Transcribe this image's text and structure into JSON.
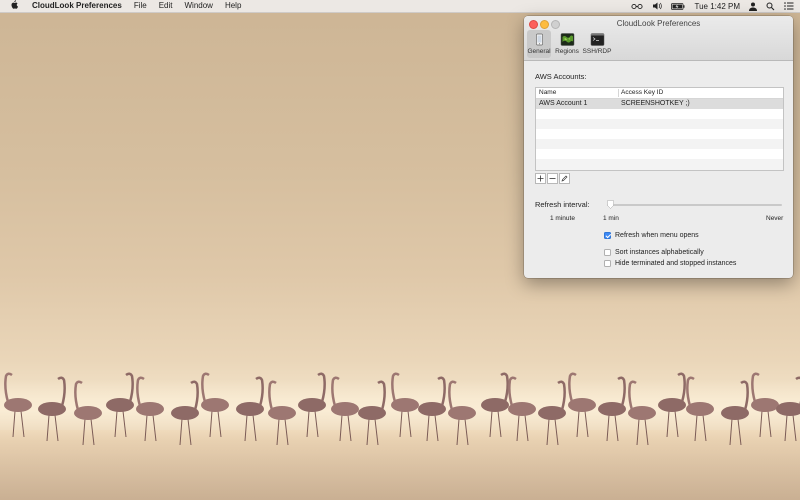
{
  "menubar": {
    "app_name": "CloudLook Preferences",
    "menus": [
      "File",
      "Edit",
      "Window",
      "Help"
    ],
    "clock": "Tue 1:42 PM",
    "status_icons": [
      "cloudlook-glasses-icon",
      "volume-icon",
      "battery-icon",
      "user-icon",
      "spotlight-search-icon",
      "notification-list-icon"
    ]
  },
  "window": {
    "title": "CloudLook Preferences",
    "toolbar": [
      {
        "label": "General",
        "icon": "general-phone-icon",
        "selected": true
      },
      {
        "label": "Regions",
        "icon": "regions-map-icon",
        "selected": false
      },
      {
        "label": "SSH/RDP",
        "icon": "terminal-icon",
        "selected": false
      }
    ],
    "aws_accounts_label": "AWS Accounts:",
    "table": {
      "columns": [
        "Name",
        "Access Key ID"
      ],
      "rows": [
        {
          "name": "AWS Account 1",
          "key": "SCREENSHOTKEY ;)",
          "selected": true
        }
      ]
    },
    "table_buttons": [
      "add-icon",
      "remove-icon",
      "edit-pencil-icon"
    ],
    "refresh": {
      "label": "Refresh interval:",
      "tick_labels": [
        "1 minute",
        "1 min",
        "Never"
      ],
      "slider_value": "1 min"
    },
    "options": [
      {
        "label": "Refresh when menu opens",
        "checked": true
      },
      {
        "label": "Sort instances alphabetically",
        "checked": false
      },
      {
        "label": "Hide terminated and stopped instances",
        "checked": false
      }
    ],
    "colors": {
      "accent": "#3d89f5",
      "close": "#fc605c",
      "minimize": "#fdbc40"
    }
  }
}
